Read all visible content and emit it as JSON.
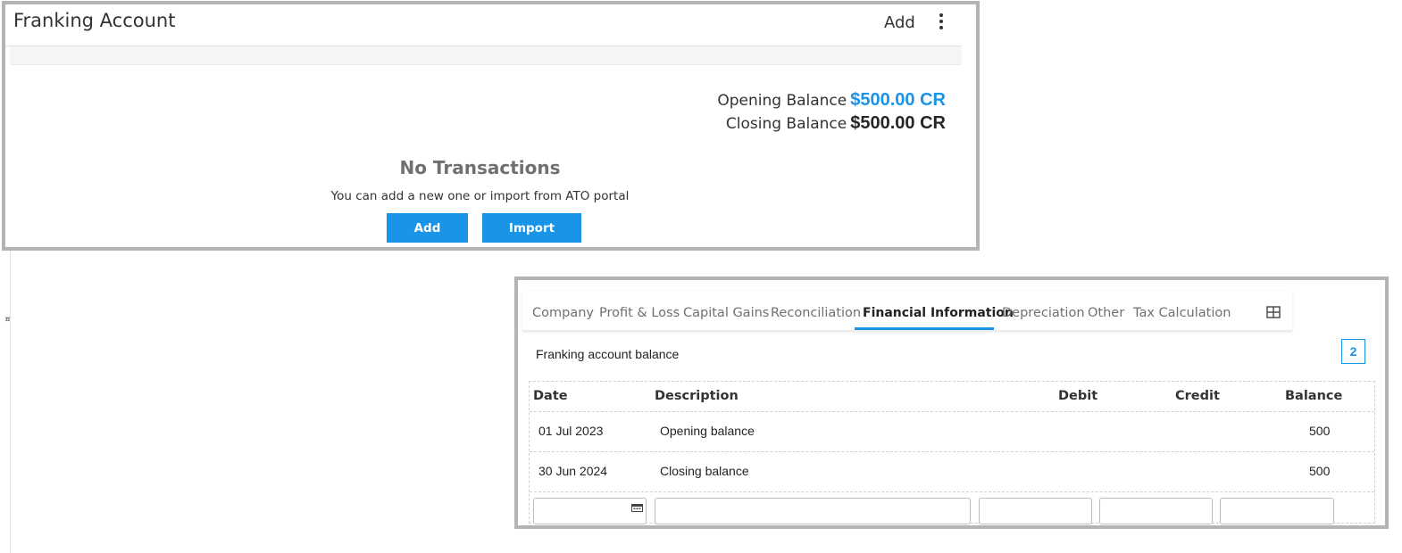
{
  "stray_mark": "¤",
  "franking_panel": {
    "title": "Franking Account",
    "add_label": "Add",
    "more_icon": "kebab-menu-icon",
    "opening_label": "Opening Balance",
    "opening_amount": "$500.00 CR",
    "closing_label": "Closing Balance",
    "closing_amount": "$500.00 CR",
    "empty_title": "No Transactions",
    "empty_subtitle": "You can add a new one or import from ATO portal",
    "add_button": "Add",
    "import_button": "Import",
    "accent_color": "#1a94e6"
  },
  "workpaper_panel": {
    "tabs": [
      {
        "label": "Company"
      },
      {
        "label": "Profit & Loss"
      },
      {
        "label": "Capital Gains"
      },
      {
        "label": "Reconciliation"
      },
      {
        "label": "Financial Information",
        "active": true
      },
      {
        "label": "Depreciation"
      },
      {
        "label": "Other"
      },
      {
        "label": "Tax Calculation"
      }
    ],
    "grid_icon": "grid-layout-icon",
    "section_label": "Franking account balance",
    "badge": "2",
    "table": {
      "columns": [
        "Date",
        "Description",
        "Debit",
        "Credit",
        "Balance"
      ],
      "rows": [
        {
          "date": "01 Jul 2023",
          "description": "Opening balance",
          "debit": "",
          "credit": "",
          "balance": "500"
        },
        {
          "date": "30 Jun 2024",
          "description": "Closing balance",
          "debit": "",
          "credit": "",
          "balance": "500"
        }
      ]
    }
  }
}
